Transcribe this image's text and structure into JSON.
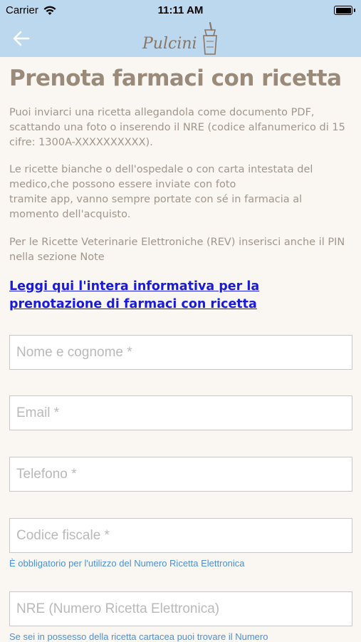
{
  "status_bar": {
    "carrier": "Carrier",
    "time": "11:11 AM"
  },
  "nav": {
    "back_icon": "arrow-left-icon",
    "logo_text": "Pulcini"
  },
  "page": {
    "title": "Prenota farmaci con ricetta",
    "paragraph1": "Puoi inviarci una ricetta allegandola come documento PDF, scattando una foto o inserendo il NRE (codice alfanumerico di 15 cifre: 1300A-XXXXXXXXXX).",
    "paragraph2_line1": "Le ricette bianche o dell'ospedale o con carta intestata del medico,che possono essere inviate con foto",
    "paragraph2_line2": "tramite app, vanno sempre portate con sé in farmacia al momento dell'acquisto.",
    "paragraph3": "Per le Ricette Veterinarie Elettroniche (REV) inserisci anche il PIN nella sezione Note",
    "info_link": "Leggi qui l'intera informativa per la prenotazione di farmaci con ricetta"
  },
  "form": {
    "name_placeholder": "Nome e cognome *",
    "email_placeholder": "Email *",
    "phone_placeholder": "Telefono *",
    "fiscal_code_placeholder": "Codice fiscale *",
    "fiscal_code_hint": "È obbligatorio per l'utilizzo del Numero Ricetta Elettronica",
    "nre_placeholder": "NRE (Numero Ricetta Elettronica)",
    "nre_hint": "Se sei in possesso della ricetta cartacea puoi trovare il Numero"
  },
  "colors": {
    "header_bg": "#bcd8ee",
    "title": "#9a8a79",
    "body_text": "#a1958b",
    "link": "#1a1adb",
    "hint": "#4a90d9"
  }
}
